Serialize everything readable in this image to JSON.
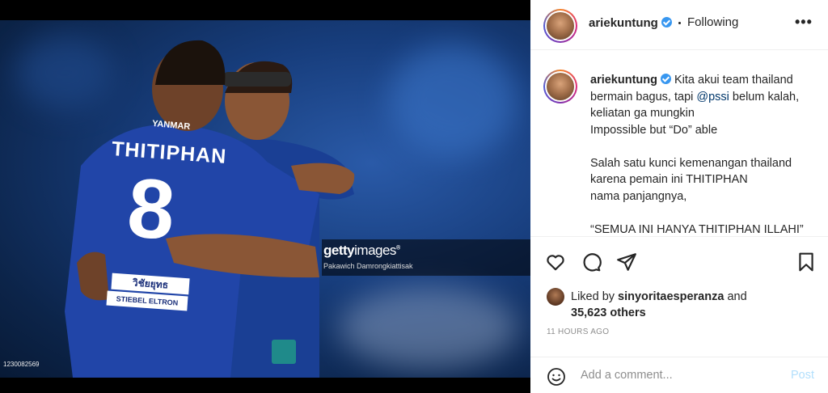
{
  "photo": {
    "jersey_name": "THITIPHAN",
    "jersey_number": "8",
    "sponsor_top": "YANMAR",
    "sponsor_1": "วิชัยยุทธ",
    "sponsor_2": "STIEBEL ELTRON",
    "gi_brand_bold": "getty",
    "gi_brand_rest": "images",
    "gi_registered": "®",
    "photographer": "Pakawich Damrongkiattisak",
    "image_id": "1230082569"
  },
  "header": {
    "username": "ariekuntung",
    "separator": "•",
    "follow_state": "Following",
    "more": "•••"
  },
  "caption": {
    "username": "ariekuntung",
    "line1_before": " Kita akui team thailand bermain bagus, tapi ",
    "mention": "@pssi",
    "line1_after": " belum kalah, keliatan ga mungkin",
    "line2": "Impossible but “Do” able",
    "line3": "Salah satu kunci kemenangan thailand karena pemain ini THITIPHAN",
    "line4": "nama panjangnya,",
    "line5": "“SEMUA INI HANYA THITIPHAN ILLAHI”"
  },
  "likes": {
    "prefix": "Liked by ",
    "user": "sinyoritaesperanza",
    "connector": " and",
    "count": "35,623 others"
  },
  "timestamp": "11 HOURS AGO",
  "comment": {
    "placeholder": "Add a comment...",
    "post_label": "Post"
  },
  "icons": {
    "like": "heart-icon",
    "comment": "comment-icon",
    "share": "paper-plane-icon",
    "save": "bookmark-icon",
    "emoji": "smiley-icon"
  },
  "colors": {
    "verified": "#3897f0",
    "mention": "#00376b",
    "post_disabled": "#b2dffc",
    "muted": "#8e8e8e"
  }
}
